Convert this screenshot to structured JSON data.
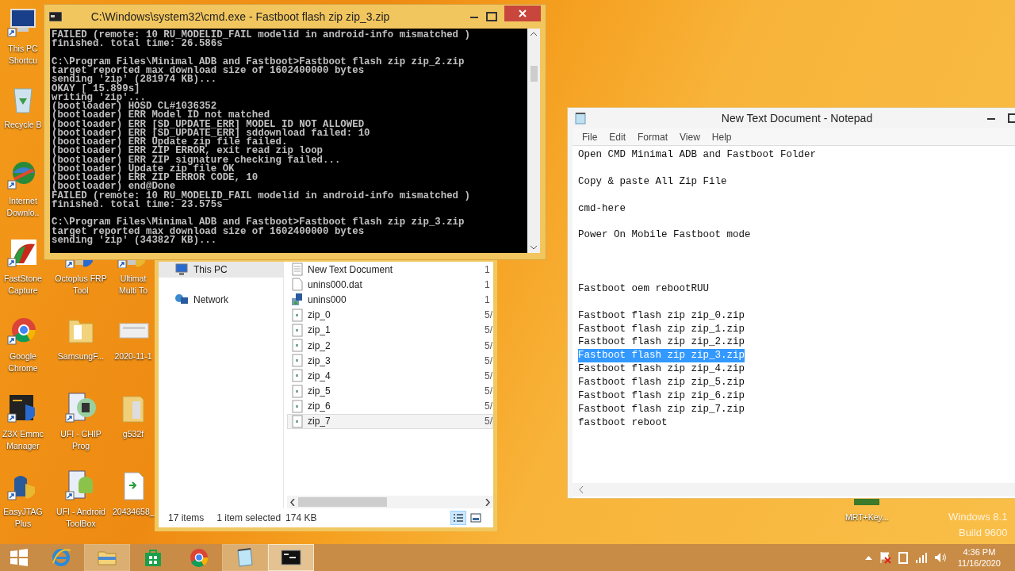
{
  "desktop_icons": [
    {
      "label": "This PC Shortcu"
    },
    {
      "label": "Recycle B"
    },
    {
      "label": "Internet Downlo.."
    },
    {
      "label": "FastStone Capture"
    },
    {
      "label": "Octoplus FRP Tool"
    },
    {
      "label": "Ultimat Multi To"
    },
    {
      "label": "Google Chrome"
    },
    {
      "label": "SamsungF..."
    },
    {
      "label": "2020-11-1"
    },
    {
      "label": "Z3X Emmc Manager"
    },
    {
      "label": "UFI - CHIP Prog"
    },
    {
      "label": "g532f"
    },
    {
      "label": "EasyJTAG Plus"
    },
    {
      "label": "UFI - Android ToolBox"
    },
    {
      "label": "20434658_"
    },
    {
      "label": "MRT+Key..."
    }
  ],
  "desktop_watermark": [
    "Windows 8.1",
    "Build 9600"
  ],
  "cmd": {
    "title": "C:\\Windows\\system32\\cmd.exe - Fastboot  flash zip zip_3.zip",
    "lines": [
      {
        "kind": "text",
        "text": "FAILED (remote: 10 RU_MODELID_FAIL modelid in android-info mismatched )"
      },
      {
        "kind": "text",
        "text": "finished. total time: 26.586s"
      },
      {
        "kind": "blank"
      },
      {
        "kind": "text",
        "text": "C:\\Program Files\\Minimal ADB and Fastboot>Fastboot flash zip zip_2.zip"
      },
      {
        "kind": "text",
        "text": "target reported max download size of 1602400000 bytes"
      },
      {
        "kind": "text",
        "text": "sending 'zip' (281974 KB)..."
      },
      {
        "kind": "text",
        "text": "OKAY [ 15.899s]"
      },
      {
        "kind": "text",
        "text": "writing 'zip'..."
      },
      {
        "kind": "text",
        "text": "(bootloader) HOSD CL#1036352"
      },
      {
        "kind": "text",
        "text": "(bootloader) ERR Model ID not matched"
      },
      {
        "kind": "text",
        "text": "(bootloader) ERR [SD_UPDATE_ERR] MODEL ID NOT ALLOWED"
      },
      {
        "kind": "text",
        "text": "(bootloader) ERR [SD_UPDATE_ERR] sddownload failed: 10"
      },
      {
        "kind": "text",
        "text": "(bootloader) ERR Update zip file failed."
      },
      {
        "kind": "text",
        "text": "(bootloader) ERR ZIP ERROR, exit read zip loop"
      },
      {
        "kind": "text",
        "text": "(bootloader) ERR ZIP signature checking failed..."
      },
      {
        "kind": "text",
        "text": "(bootloader) Update zip file OK"
      },
      {
        "kind": "text",
        "text": "(bootloader) ERR ZIP ERROR CODE, 10"
      },
      {
        "kind": "text",
        "text": "(bootloader) end@Done"
      },
      {
        "kind": "text",
        "text": "FAILED (remote: 10 RU_MODELID_FAIL modelid in android-info mismatched )"
      },
      {
        "kind": "text",
        "text": "finished. total time: 23.575s"
      },
      {
        "kind": "blank"
      },
      {
        "kind": "text",
        "text": "C:\\Program Files\\Minimal ADB and Fastboot>Fastboot flash zip zip_3.zip"
      },
      {
        "kind": "text",
        "text": "target reported max download size of 1602400000 bytes"
      },
      {
        "kind": "text",
        "text": "sending 'zip' (343827 KB)..."
      }
    ]
  },
  "explorer": {
    "nav": [
      {
        "label": "This PC",
        "selected": true
      },
      {
        "label": "Network",
        "selected": false
      }
    ],
    "files": [
      {
        "name": "New Text Document",
        "kind": "text",
        "date": "1",
        "selected": false
      },
      {
        "name": "unins000.dat",
        "kind": "file",
        "date": "1",
        "selected": false
      },
      {
        "name": "unins000",
        "kind": "setup",
        "date": "1",
        "selected": false
      },
      {
        "name": "zip_0",
        "kind": "zip",
        "date": "5/",
        "selected": false
      },
      {
        "name": "zip_1",
        "kind": "zip",
        "date": "5/",
        "selected": false
      },
      {
        "name": "zip_2",
        "kind": "zip",
        "date": "5/",
        "selected": false
      },
      {
        "name": "zip_3",
        "kind": "zip",
        "date": "5/",
        "selected": false
      },
      {
        "name": "zip_4",
        "kind": "zip",
        "date": "5/",
        "selected": false
      },
      {
        "name": "zip_5",
        "kind": "zip",
        "date": "5/",
        "selected": false
      },
      {
        "name": "zip_6",
        "kind": "zip",
        "date": "5/",
        "selected": false
      },
      {
        "name": "zip_7",
        "kind": "zip",
        "date": "5/",
        "selected": true
      }
    ],
    "status": {
      "count": "17 items",
      "selection": "1 item selected",
      "size": "174 KB"
    },
    "views": [
      {
        "kind": "details",
        "selected": true
      },
      {
        "kind": "tiles",
        "selected": false
      }
    ]
  },
  "notepad": {
    "title": "New Text Document - Notepad",
    "menu": [
      "File",
      "Edit",
      "Format",
      "View",
      "Help"
    ],
    "lines": [
      {
        "kind": "text",
        "text": "Open CMD Minimal ADB and Fastboot Folder",
        "selected": false
      },
      {
        "kind": "blank"
      },
      {
        "kind": "text",
        "text": "Copy & paste All Zip File",
        "selected": false
      },
      {
        "kind": "blank"
      },
      {
        "kind": "text",
        "text": "cmd-here",
        "selected": false
      },
      {
        "kind": "blank"
      },
      {
        "kind": "text",
        "text": "Power On Mobile Fastboot mode",
        "selected": false
      },
      {
        "kind": "blank"
      },
      {
        "kind": "blank"
      },
      {
        "kind": "blank"
      },
      {
        "kind": "text",
        "text": "Fastboot oem rebootRUU",
        "selected": false
      },
      {
        "kind": "blank"
      },
      {
        "kind": "text",
        "text": "Fastboot flash zip zip_0.zip",
        "selected": false
      },
      {
        "kind": "text",
        "text": "Fastboot flash zip zip_1.zip",
        "selected": false
      },
      {
        "kind": "text",
        "text": "Fastboot flash zip zip_2.zip",
        "selected": false
      },
      {
        "kind": "text",
        "text": "Fastboot flash zip zip_3.zip",
        "selected": true
      },
      {
        "kind": "text",
        "text": "Fastboot flash zip zip_4.zip",
        "selected": false
      },
      {
        "kind": "text",
        "text": "Fastboot flash zip zip_5.zip",
        "selected": false
      },
      {
        "kind": "text",
        "text": "Fastboot flash zip zip_6.zip",
        "selected": false
      },
      {
        "kind": "text",
        "text": "Fastboot flash zip zip_7.zip",
        "selected": false
      },
      {
        "kind": "text",
        "text": "fastboot reboot",
        "selected": false
      }
    ]
  },
  "taskbar": {
    "apps": [
      {
        "kind": "ie",
        "running": false,
        "selected": false
      },
      {
        "kind": "explorer",
        "running": true,
        "selected": false
      },
      {
        "kind": "store",
        "running": false,
        "selected": false
      },
      {
        "kind": "chrome",
        "running": false,
        "selected": false
      },
      {
        "kind": "notepad",
        "running": true,
        "selected": false
      },
      {
        "kind": "cmd",
        "running": true,
        "selected": true
      }
    ],
    "time": "4:36 PM",
    "date": "11/16/2020"
  }
}
